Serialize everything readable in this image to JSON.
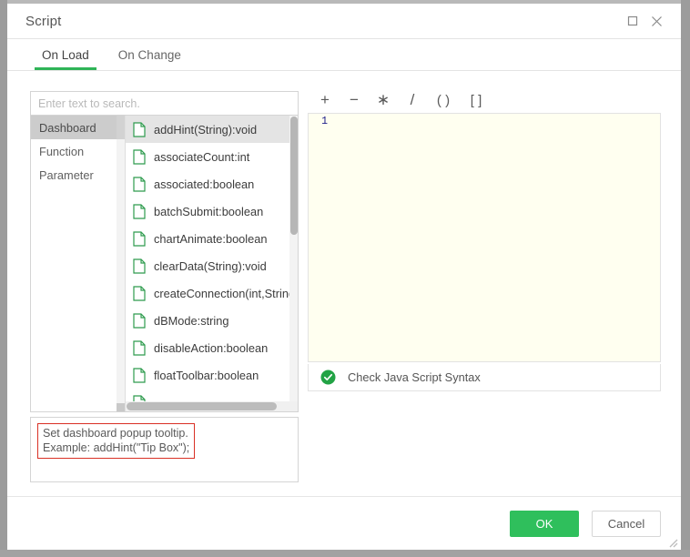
{
  "window": {
    "title": "Script",
    "maximize_icon": "maximize-icon",
    "close_icon": "close-icon"
  },
  "tabs": [
    {
      "label": "On Load",
      "active": true
    },
    {
      "label": "On Change",
      "active": false
    }
  ],
  "search": {
    "placeholder": "Enter text to search.",
    "value": ""
  },
  "categories": [
    {
      "label": "Dashboard",
      "selected": true
    },
    {
      "label": "Function",
      "selected": false
    },
    {
      "label": "Parameter",
      "selected": false
    }
  ],
  "members": [
    {
      "label": "addHint(String):void",
      "selected": true
    },
    {
      "label": "associateCount:int",
      "selected": false
    },
    {
      "label": "associated:boolean",
      "selected": false
    },
    {
      "label": "batchSubmit:boolean",
      "selected": false
    },
    {
      "label": "chartAnimate:boolean",
      "selected": false
    },
    {
      "label": "clearData(String):void",
      "selected": false
    },
    {
      "label": "createConnection(int,String):",
      "selected": false
    },
    {
      "label": "dBMode:string",
      "selected": false
    },
    {
      "label": "disableAction:boolean",
      "selected": false
    },
    {
      "label": "floatToolbar:boolean",
      "selected": false
    }
  ],
  "description": "Set dashboard popup tooltip.\nExample: addHint(\"Tip Box\");",
  "operators": [
    {
      "label": "+",
      "name": "plus"
    },
    {
      "label": "−",
      "name": "minus"
    },
    {
      "label": "∗",
      "name": "multiply"
    },
    {
      "label": "/",
      "name": "divide"
    },
    {
      "label": "( )",
      "name": "parentheses"
    },
    {
      "label": "[ ]",
      "name": "brackets"
    }
  ],
  "editor": {
    "line_number": "1",
    "content": ""
  },
  "syntax_check": {
    "label": "Check Java Script Syntax",
    "icon": "check-circle-icon",
    "status_color": "#22a345"
  },
  "footer": {
    "ok_label": "OK",
    "cancel_label": "Cancel"
  },
  "colors": {
    "accent_green": "#2fbf5c",
    "tab_underline": "#2fb457",
    "desc_border": "#d93025",
    "doc_icon": "#2e9b4e",
    "line_number": "#20208a",
    "editor_bg": "#fffff0"
  }
}
